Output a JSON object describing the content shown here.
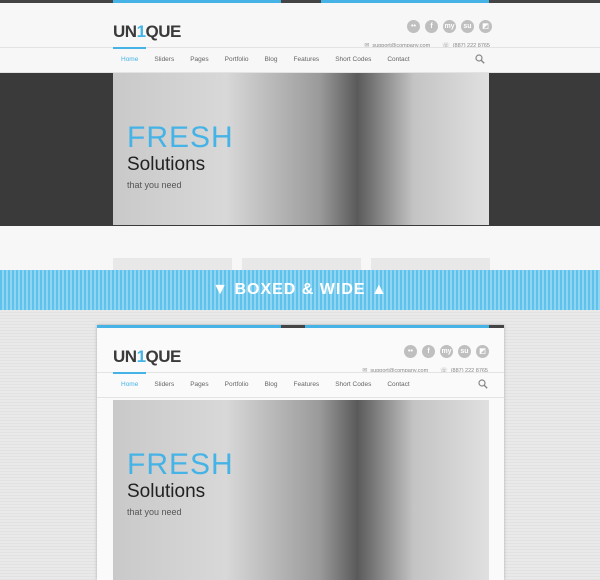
{
  "logo": {
    "prefix": "UN",
    "accent": "1",
    "suffix": "QUE"
  },
  "social_icons": [
    "flickr-icon",
    "facebook-icon",
    "myspace-icon",
    "stumbleupon-icon",
    "delicious-icon"
  ],
  "social_glyphs": [
    "••",
    "f",
    "my",
    "su",
    "◩"
  ],
  "contact": {
    "email": "support@company.com",
    "phone": "(887) 222 8765"
  },
  "nav": {
    "items": [
      "Home",
      "Sliders",
      "Pages",
      "Portfolio",
      "Blog",
      "Features",
      "Short Codes",
      "Contact"
    ],
    "active": "Home"
  },
  "hero": {
    "headline": "FRESH",
    "subheadline": "Solutions",
    "tagline": "that you need"
  },
  "divider": {
    "label": "▼ BOXED & WIDE ▲"
  },
  "colors": {
    "accent": "#46b3e6",
    "dark": "#3a3a3a",
    "banner": "#5fc2ec"
  }
}
